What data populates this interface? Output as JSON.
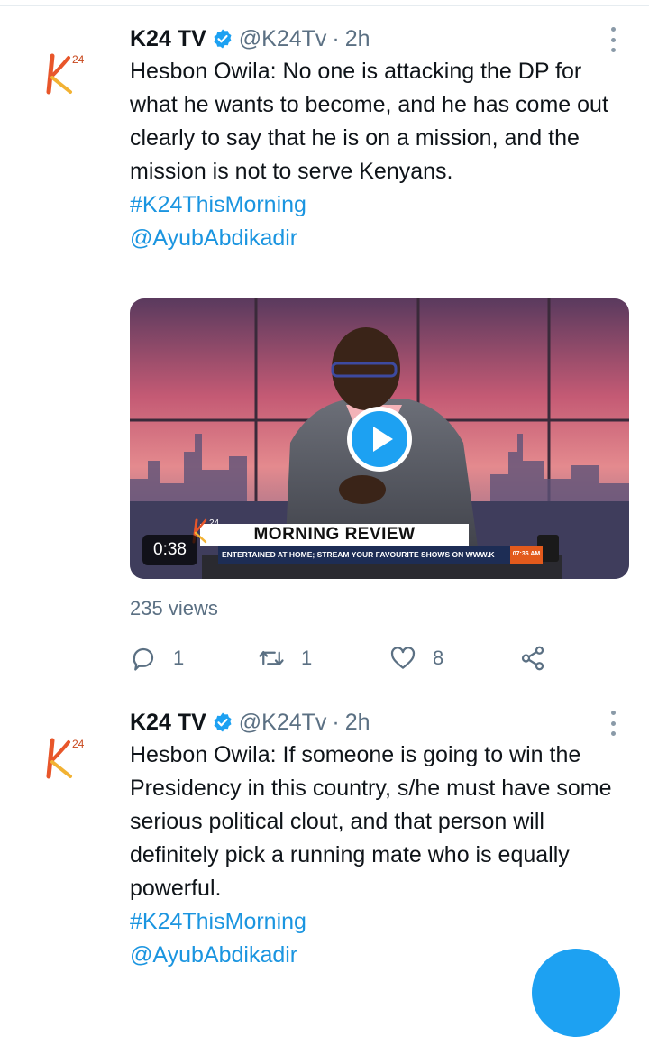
{
  "colors": {
    "link": "#1b95e0",
    "muted": "#5b7083",
    "verified": "#1da1f2",
    "fab": "#1da1f2"
  },
  "tweets": [
    {
      "name": "K24 TV",
      "handle": "@K24Tv",
      "separator": "·",
      "time": "2h",
      "text": "Hesbon Owila: No one is attacking the DP for what he wants to become, and he has come out clearly to say that he is on a mission, and the mission is not to serve Kenyans.",
      "hashtag": "#K24ThisMorning",
      "mention": "@AyubAbdikadir",
      "video": {
        "duration": "0:38",
        "lower_third_title": "MORNING REVIEW",
        "ticker": "ENTERTAINED AT HOME; STREAM YOUR FAVOURITE SHOWS ON WWW.K",
        "clock": "07:36 AM",
        "channel_bug": "24"
      },
      "views": "235 views",
      "replies": "1",
      "retweets": "1",
      "likes": "8"
    },
    {
      "name": "K24 TV",
      "handle": "@K24Tv",
      "separator": "·",
      "time": "2h",
      "text": "Hesbon Owila: If someone is going to win the Presidency in this country, s/he must have some serious political clout, and that person will definitely pick a running mate who is equally powerful.",
      "hashtag": "#K24ThisMorning",
      "mention": "@AyubAbdikadir"
    }
  ]
}
